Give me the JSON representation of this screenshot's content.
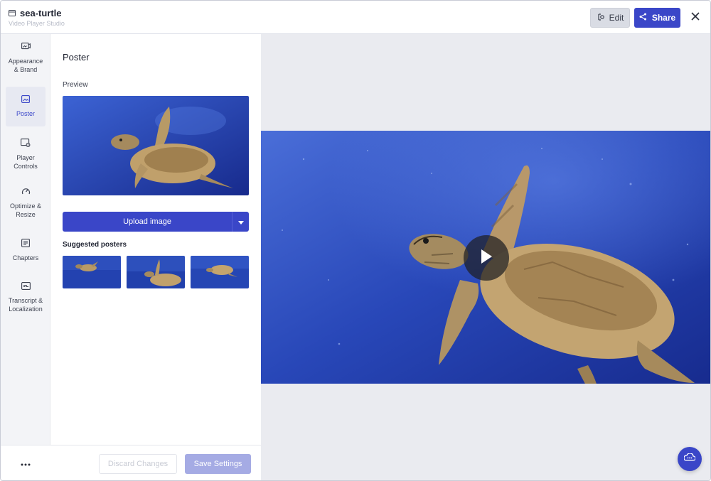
{
  "header": {
    "title": "sea-turtle",
    "subtitle": "Video Player Studio",
    "edit_label": "Edit",
    "share_label": "Share"
  },
  "nav": {
    "items": [
      {
        "label": "Appearance & Brand",
        "icon": "brand-icon"
      },
      {
        "label": "Poster",
        "icon": "image-icon",
        "active": true
      },
      {
        "label": "Player Controls",
        "icon": "player-controls-icon"
      },
      {
        "label": "Optimize & Resize",
        "icon": "gauge-icon"
      },
      {
        "label": "Chapters",
        "icon": "list-icon"
      },
      {
        "label": "Transcript & Localization",
        "icon": "captions-icon"
      }
    ],
    "code_icon": "code-icon"
  },
  "panel": {
    "title": "Poster",
    "preview_label": "Preview",
    "upload_label": "Upload image",
    "suggested_label": "Suggested posters"
  },
  "footer": {
    "discard_label": "Discard Changes",
    "save_label": "Save Settings"
  },
  "colors": {
    "accent": "#3a46c8",
    "ocean_dark": "#1a2f8a",
    "ocean_light": "#3b63d6"
  }
}
